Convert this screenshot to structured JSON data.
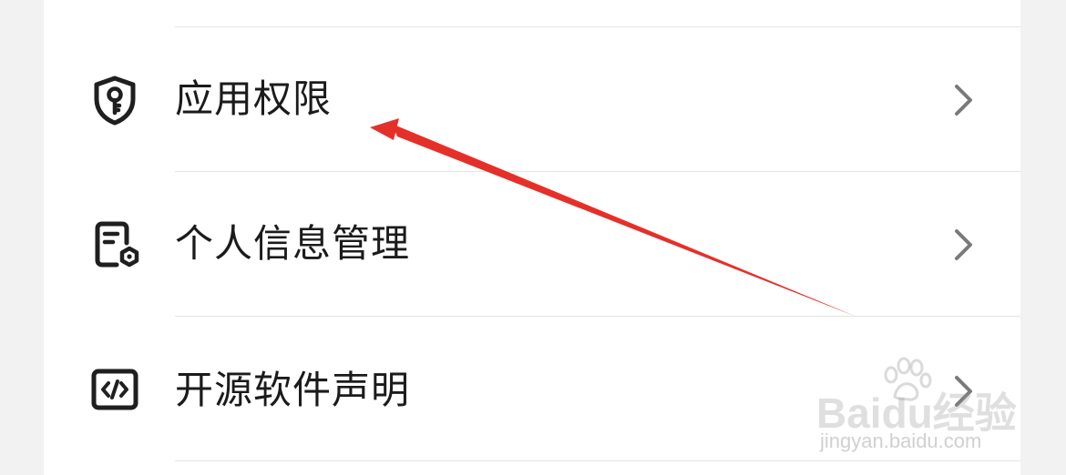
{
  "settings_list": {
    "items": [
      {
        "label": "应用权限",
        "icon": "shield-key-icon"
      },
      {
        "label": "个人信息管理",
        "icon": "document-gear-icon"
      },
      {
        "label": "开源软件声明",
        "icon": "code-icon"
      }
    ]
  },
  "watermark": {
    "brand": "Baidu经验",
    "url": "jingyan.baidu.com"
  },
  "colors": {
    "background": "#f2f2f2",
    "panel": "#ffffff",
    "text": "#1b1b1b",
    "icon": "#1f1f1f",
    "chevron": "#7a7a7a",
    "divider": "#e4e4e4",
    "annotation_arrow": "#e5302a"
  }
}
